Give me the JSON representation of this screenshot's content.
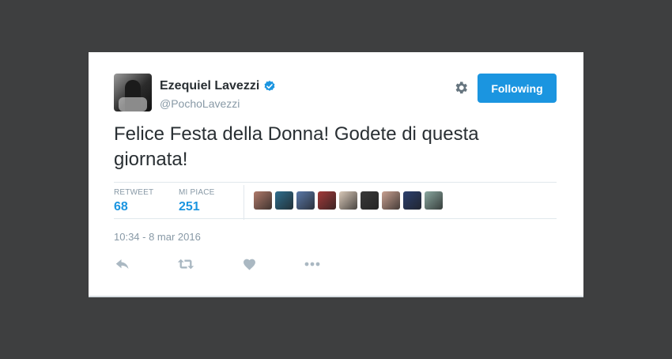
{
  "tweet": {
    "author": {
      "name": "Ezequiel Lavezzi",
      "handle": "@PochoLavezzi",
      "verified": true
    },
    "follow_button_label": "Following",
    "text": "Felice Festa della Donna! Godete di questa giornata!",
    "stats": {
      "retweet_label": "RETWEET",
      "retweet_count": "68",
      "likes_label": "MI PIACE",
      "likes_count": "251"
    },
    "liker_avatars": [
      {
        "name": "liker-avatar-1",
        "color": "#b07a6a"
      },
      {
        "name": "liker-avatar-2",
        "color": "#2f6e8e"
      },
      {
        "name": "liker-avatar-3",
        "color": "#5a78a8"
      },
      {
        "name": "liker-avatar-4",
        "color": "#a33a3a"
      },
      {
        "name": "liker-avatar-5",
        "color": "#d8c8b8"
      },
      {
        "name": "liker-avatar-6",
        "color": "#3a3a3a"
      },
      {
        "name": "liker-avatar-7",
        "color": "#c8a090"
      },
      {
        "name": "liker-avatar-8",
        "color": "#2b3f6e"
      },
      {
        "name": "liker-avatar-9",
        "color": "#8aa8a0"
      }
    ],
    "timestamp": "10:34 - 8 mar 2016",
    "actions": [
      "reply-icon",
      "retweet-icon",
      "heart-icon",
      "more-icon"
    ]
  },
  "colors": {
    "background": "#3e3f40",
    "accent": "#1b95e0",
    "text": "#292f33",
    "muted": "#8899a6",
    "action_icon": "#aab8c2"
  }
}
